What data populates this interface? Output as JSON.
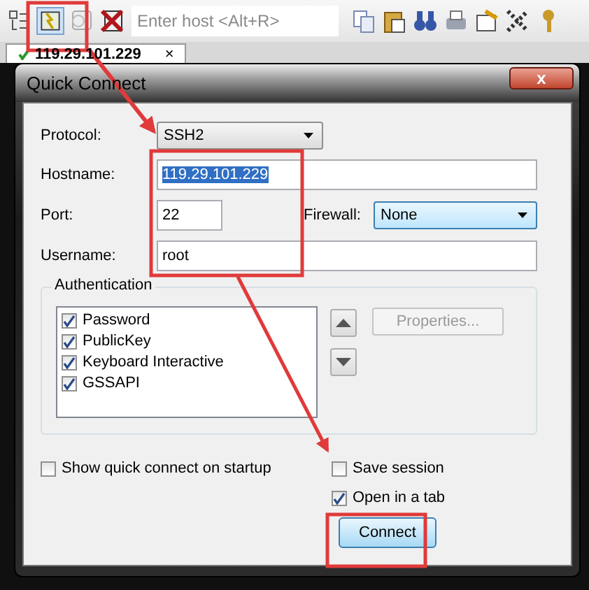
{
  "toolbar": {
    "host_field": {
      "placeholder": "Enter host <Alt+R>"
    }
  },
  "tabs": [
    {
      "label": "119.29.101.229",
      "close": "×",
      "selected": true
    }
  ],
  "dialog": {
    "title": "Quick Connect",
    "close": "x",
    "protocol": {
      "label": "Protocol:",
      "value": "SSH2"
    },
    "hostname": {
      "label": "Hostname:",
      "value": "119.29.101.229",
      "selected": true
    },
    "port": {
      "label": "Port:",
      "value": "22"
    },
    "firewall": {
      "label": "Firewall:",
      "value": "None"
    },
    "username": {
      "label": "Username:",
      "value": "root"
    },
    "authentication": {
      "title": "Authentication",
      "methods": [
        {
          "label": "Password",
          "checked": true
        },
        {
          "label": "PublicKey",
          "checked": true
        },
        {
          "label": "Keyboard Interactive",
          "checked": true
        },
        {
          "label": "GSSAPI",
          "checked": true
        }
      ],
      "properties_button": {
        "label": "Properties...",
        "disabled": true
      }
    },
    "options": [
      {
        "label": "Show quick connect on startup",
        "checked": false
      },
      {
        "label": "Save session",
        "checked": false
      },
      {
        "label": "Open in a tab",
        "checked": true
      }
    ],
    "buttons": [
      "Connect"
    ]
  }
}
